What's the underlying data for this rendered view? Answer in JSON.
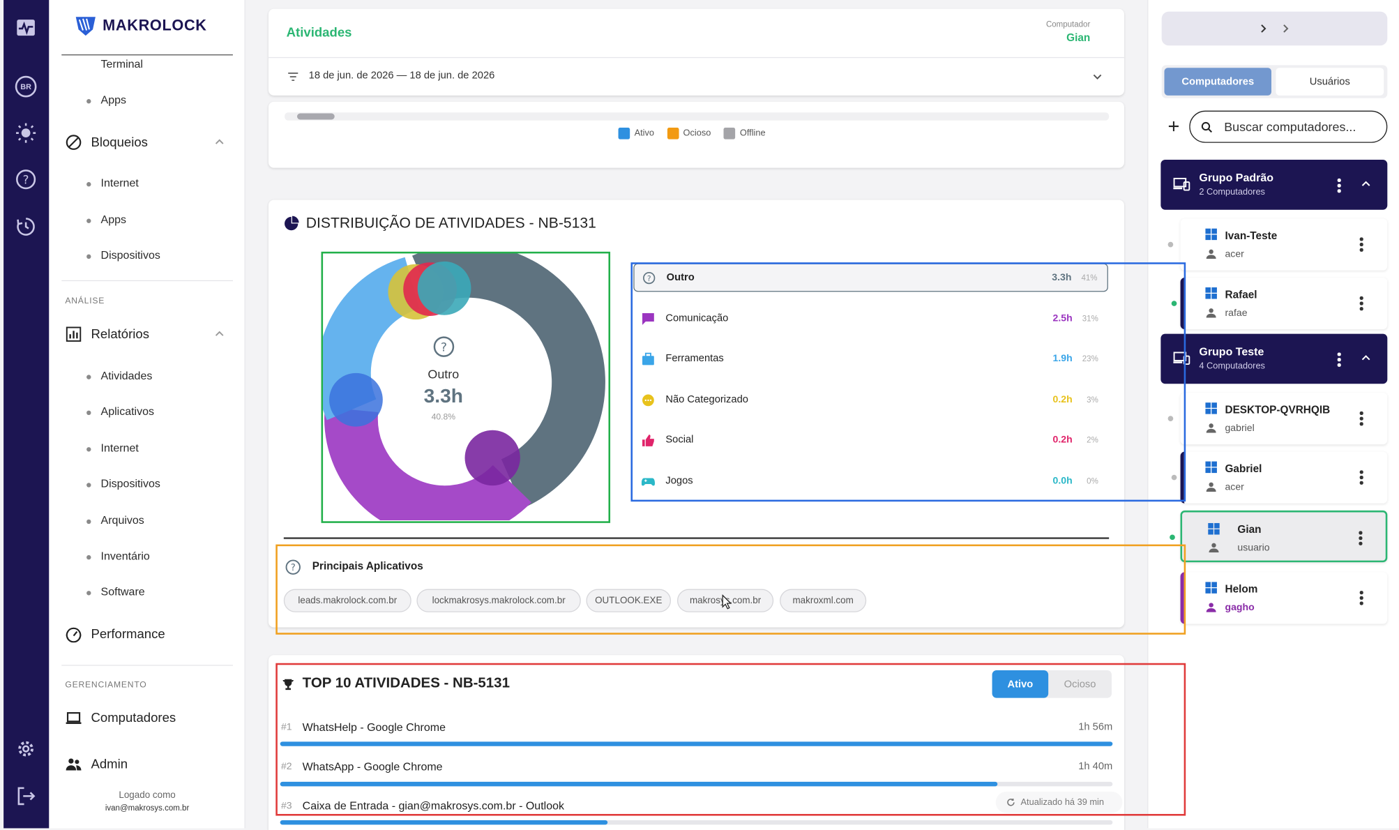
{
  "brand": {
    "name": "MAKROLOCK",
    "accent": "#1c1552",
    "green": "#2bb673"
  },
  "rail": {
    "lang": "BR"
  },
  "nav": {
    "terminal": "Terminal",
    "apps_1": "Apps",
    "bloqueios": "Bloqueios",
    "internet_1": "Internet",
    "apps_2": "Apps",
    "dispositivos_1": "Dispositivos",
    "section_analise": "ANÁLISE",
    "relatorios": "Relatórios",
    "atividades": "Atividades",
    "aplicativos": "Aplicativos",
    "internet_2": "Internet",
    "dispositivos_2": "Dispositivos",
    "arquivos": "Arquivos",
    "inventario": "Inventário",
    "software": "Software",
    "performance": "Performance",
    "section_gerenciamento": "GERENCIAMENTO",
    "computadores": "Computadores",
    "admin": "Admin",
    "logged_as": "Logado como",
    "user_email": "ivan@makrosys.com.br"
  },
  "header": {
    "title": "Atividades",
    "computer_label": "Computador",
    "computer_value": "Gian",
    "date_range": "18 de jun. de 2026 — 18 de jun. de 2026"
  },
  "legend": {
    "ativo": "Ativo",
    "ocioso": "Ocioso",
    "offline": "Offline"
  },
  "distribution": {
    "title": "DISTRIBUIÇÃO DE ATIVIDADES - NB-5131",
    "center_label": "Outro",
    "center_value": "3.3h",
    "center_pct": "40.8%",
    "categories": [
      {
        "name": "Outro",
        "value": "3.3h",
        "pct": "41%",
        "color": "#5f7380",
        "icon": "help-icon"
      },
      {
        "name": "Comunicação",
        "value": "2.5h",
        "pct": "31%",
        "color": "#9b35c0",
        "icon": "chat-icon"
      },
      {
        "name": "Ferramentas",
        "value": "1.9h",
        "pct": "23%",
        "color": "#3aa5e8",
        "icon": "briefcase-icon"
      },
      {
        "name": "Não Categorizado",
        "value": "0.2h",
        "pct": "3%",
        "color": "#e8c21c",
        "icon": "dots-icon"
      },
      {
        "name": "Social",
        "value": "0.2h",
        "pct": "2%",
        "color": "#e0246a",
        "icon": "thumb-up-icon"
      },
      {
        "name": "Jogos",
        "value": "0.0h",
        "pct": "0%",
        "color": "#2bb8c8",
        "icon": "gamepad-icon"
      }
    ],
    "apps_title": "Principais Aplicativos",
    "apps": [
      "leads.makrolock.com.br",
      "lockmakrosys.makrolock.com.br",
      "OUTLOOK.EXE",
      "makrosys.com.br",
      "makroxml.com"
    ]
  },
  "top10": {
    "title": "TOP 10 ATIVIDADES - NB-5131",
    "toggle_active": "Ativo",
    "toggle_idle": "Ocioso",
    "rows": [
      {
        "rank": "#1",
        "label": "WhatsHelp - Google Chrome",
        "time": "1h 56m",
        "frac": 1.0
      },
      {
        "rank": "#2",
        "label": "WhatsApp - Google Chrome",
        "time": "1h 40m",
        "frac": 0.862
      },
      {
        "rank": "#3",
        "label": "Caixa de Entrada - gian@makrosys.com.br - Outlook",
        "time": "",
        "frac": 0.393
      }
    ],
    "updated": "Atualizado há 39 min"
  },
  "right": {
    "tab_computers": "Computadores",
    "tab_users": "Usuários",
    "search_placeholder": "Buscar computadores...",
    "groups": [
      {
        "name": "Grupo Padrão",
        "count": "2 Computadores"
      },
      {
        "name": "Grupo Teste",
        "count": "4 Computadores"
      }
    ],
    "computers": [
      {
        "name": "Ivan-Teste",
        "user": "acer"
      },
      {
        "name": "Rafael",
        "user": "rafae"
      },
      {
        "name": "DESKTOP-QVRHQIB",
        "user": "gabriel"
      },
      {
        "name": "Gabriel",
        "user": "acer"
      },
      {
        "name": "Gian",
        "user": "usuario"
      },
      {
        "name": "Helom",
        "user": "gagho"
      }
    ]
  }
}
